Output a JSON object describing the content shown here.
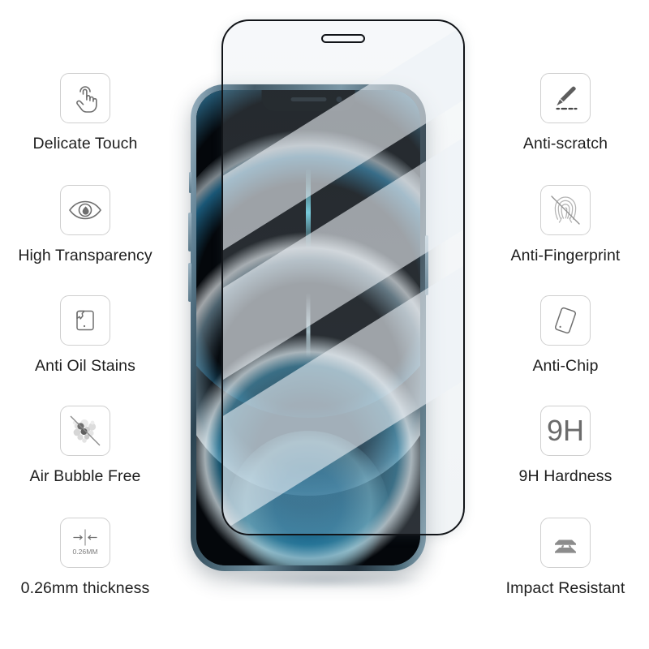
{
  "page": {
    "title": "Tempered Glass Screen Protector Feature Infographic",
    "background_color": "#ffffff",
    "label_color": "#1e1e1e",
    "icon_border_color": "#cfcfcf",
    "icon_stroke_color": "#6f6f6f"
  },
  "left_column": {
    "items": [
      {
        "icon": "tap-hand-icon",
        "label": "Delicate Touch"
      },
      {
        "icon": "eye-icon",
        "label": "High Transparency"
      },
      {
        "icon": "phone-oil-stain-icon",
        "label": "Anti Oil Stains"
      },
      {
        "icon": "no-bubbles-icon",
        "label": "Air Bubble Free"
      },
      {
        "icon": "thickness-gauge-icon",
        "label": "0.26mm thickness",
        "icon_caption": "0.26MM"
      }
    ]
  },
  "right_column": {
    "items": [
      {
        "icon": "knife-scratch-icon",
        "label": "Anti-scratch"
      },
      {
        "icon": "no-fingerprint-icon",
        "label": "Anti-Fingerprint"
      },
      {
        "icon": "tilted-phone-icon",
        "label": "Anti-Chip"
      },
      {
        "icon": "hardness-9h-icon",
        "label": "9H Hardness",
        "icon_caption": "9H"
      },
      {
        "icon": "stacked-plates-icon",
        "label": "Impact Resistant"
      }
    ]
  },
  "device": {
    "name": "iphone-12-pro",
    "body_color": "#4b6b7c",
    "screen_color": "#05090d",
    "wallpaper_accent": "#49c6e8",
    "glass_overlay": {
      "name": "tempered-glass-sheet",
      "edge_color": "#111418",
      "tint": "rgba(200,214,222,0.20)"
    }
  }
}
